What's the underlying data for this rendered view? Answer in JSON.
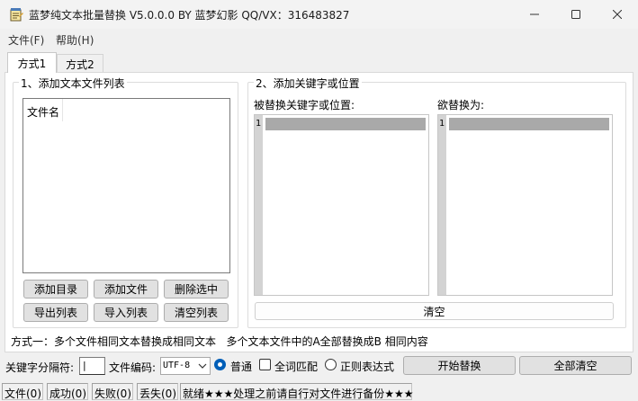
{
  "window": {
    "title": "蓝梦纯文本批量替换 V5.0.0.0 BY 蓝梦幻影 QQ/VX：316483827"
  },
  "menu": {
    "file": "文件(F)",
    "help": "帮助(H)"
  },
  "tabs": [
    {
      "label": "方式1",
      "active": true
    },
    {
      "label": "方式2",
      "active": false
    }
  ],
  "file_group": {
    "legend": "1、添加文本文件列表",
    "column_header": "文件名",
    "buttons": {
      "add_dir": "添加目录",
      "add_file": "添加文件",
      "delete_selected": "删除选中",
      "export_list": "导出列表",
      "import_list": "导入列表",
      "clear_list": "清空列表"
    }
  },
  "keyword_group": {
    "legend": "2、添加关键字或位置",
    "replace_from_label": "被替换关键字或位置:",
    "replace_to_label": "欲替换为:",
    "from_line_number": "1",
    "to_line_number": "1",
    "clear_button": "清空"
  },
  "mode_description": "方式一：多个文件相同文本替换成相同文本   多个文本文件中的A全部替换成B 相同内容",
  "options": {
    "separator_label": "关键字分隔符:",
    "separator_value": "|",
    "encoding_label": "文件编码:",
    "encoding_value": "UTF-8",
    "normal_label": "普通",
    "whole_word_label": "全词匹配",
    "regex_label": "正则表达式",
    "start_button": "开始替换",
    "clear_all_button": "全部清空"
  },
  "status": {
    "files": "文件(0)",
    "success": "成功(0)",
    "failed": "失败(0)",
    "lost": "丢失(0)",
    "message": "就绪★★★处理之前请自行对文件进行备份★★★"
  },
  "colors": {
    "accent": "#005fb8",
    "highlight_line": "#a9a9a9"
  }
}
